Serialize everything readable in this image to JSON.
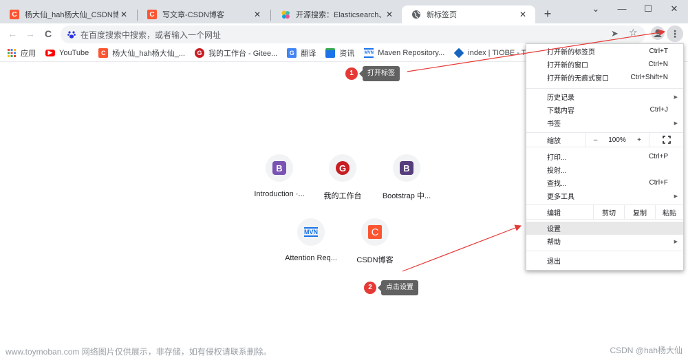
{
  "tabs": [
    {
      "title": "杨大仙_hah杨大仙_CSDN博客-",
      "icon": "csdn-icon"
    },
    {
      "title": "写文章-CSDN博客",
      "icon": "csdn-icon"
    },
    {
      "title": "开源搜索：Elasticsearch、ELK",
      "icon": "elastic-icon"
    },
    {
      "title": "新标签页",
      "icon": "globe-icon",
      "active": true
    }
  ],
  "tab_close_glyph": "✕",
  "new_tab_glyph": "+",
  "window_controls": {
    "tab_search": "⌄",
    "minimize": "—",
    "maximize": "☐",
    "close": "✕"
  },
  "toolbar": {
    "back": "←",
    "forward": "→",
    "reload": "C",
    "omnibox_placeholder": "在百度搜索中搜索，或者输入一个网址",
    "send_glyph": "➤",
    "star_glyph": "☆",
    "menu_glyph": "⋮"
  },
  "bookmarks": [
    {
      "label": "应用",
      "icon": "apps-grid-icon"
    },
    {
      "label": "YouTube",
      "icon": "youtube-icon"
    },
    {
      "label": "杨大仙_hah杨大仙_...",
      "icon": "csdn-icon"
    },
    {
      "label": "我的工作台 - Gitee...",
      "icon": "gitee-icon"
    },
    {
      "label": "翻译",
      "icon": "translate-icon"
    },
    {
      "label": "资讯",
      "icon": "news-icon"
    },
    {
      "label": "Maven Repository...",
      "icon": "maven-icon"
    },
    {
      "label": "index | TIOBE - Th...",
      "icon": "tiobe-icon"
    },
    {
      "label": "",
      "icon": "bootstrap-icon"
    }
  ],
  "shortcuts": [
    {
      "label": "Introduction ·...",
      "glyph": "B",
      "color": "#7952b3"
    },
    {
      "label": "我的工作台",
      "glyph": "G",
      "color": "#c71d23"
    },
    {
      "label": "Bootstrap 中...",
      "glyph": "B",
      "color": "#563d7c"
    },
    {
      "label": "Attention Req...",
      "glyph": "MVN",
      "color": "#1a73e8"
    },
    {
      "label": "CSDN博客",
      "glyph": "C",
      "color": "#fc5531"
    }
  ],
  "menu": {
    "new_tab": {
      "label": "打开新的标签页",
      "shortcut": "Ctrl+T"
    },
    "new_window": {
      "label": "打开新的窗口",
      "shortcut": "Ctrl+N"
    },
    "incognito": {
      "label": "打开新的无痕式窗口",
      "shortcut": "Ctrl+Shift+N"
    },
    "history": {
      "label": "历史记录"
    },
    "downloads": {
      "label": "下载内容",
      "shortcut": "Ctrl+J"
    },
    "bookmarks": {
      "label": "书签"
    },
    "zoom": {
      "label": "缩放",
      "minus": "–",
      "value": "100%",
      "plus": "+"
    },
    "print": {
      "label": "打印...",
      "shortcut": "Ctrl+P"
    },
    "cast": {
      "label": "投射..."
    },
    "find": {
      "label": "查找...",
      "shortcut": "Ctrl+F"
    },
    "more_tools": {
      "label": "更多工具"
    },
    "edit": {
      "label": "编辑",
      "cut": "剪切",
      "copy": "复制",
      "paste": "粘贴"
    },
    "settings": {
      "label": "设置"
    },
    "help": {
      "label": "帮助"
    },
    "exit": {
      "label": "退出"
    },
    "submenu_arrow": "▶"
  },
  "annotations": [
    {
      "number": "1",
      "text": "打开标签"
    },
    {
      "number": "2",
      "text": "点击设置"
    }
  ],
  "colors": {
    "annotation_red": "#e53935",
    "csdn_orange": "#fc5531"
  },
  "footer": {
    "watermark": "www.toymoban.com 网络图片仅供展示，非存储，如有侵权请联系删除。",
    "credit": "CSDN @hah杨大仙"
  }
}
